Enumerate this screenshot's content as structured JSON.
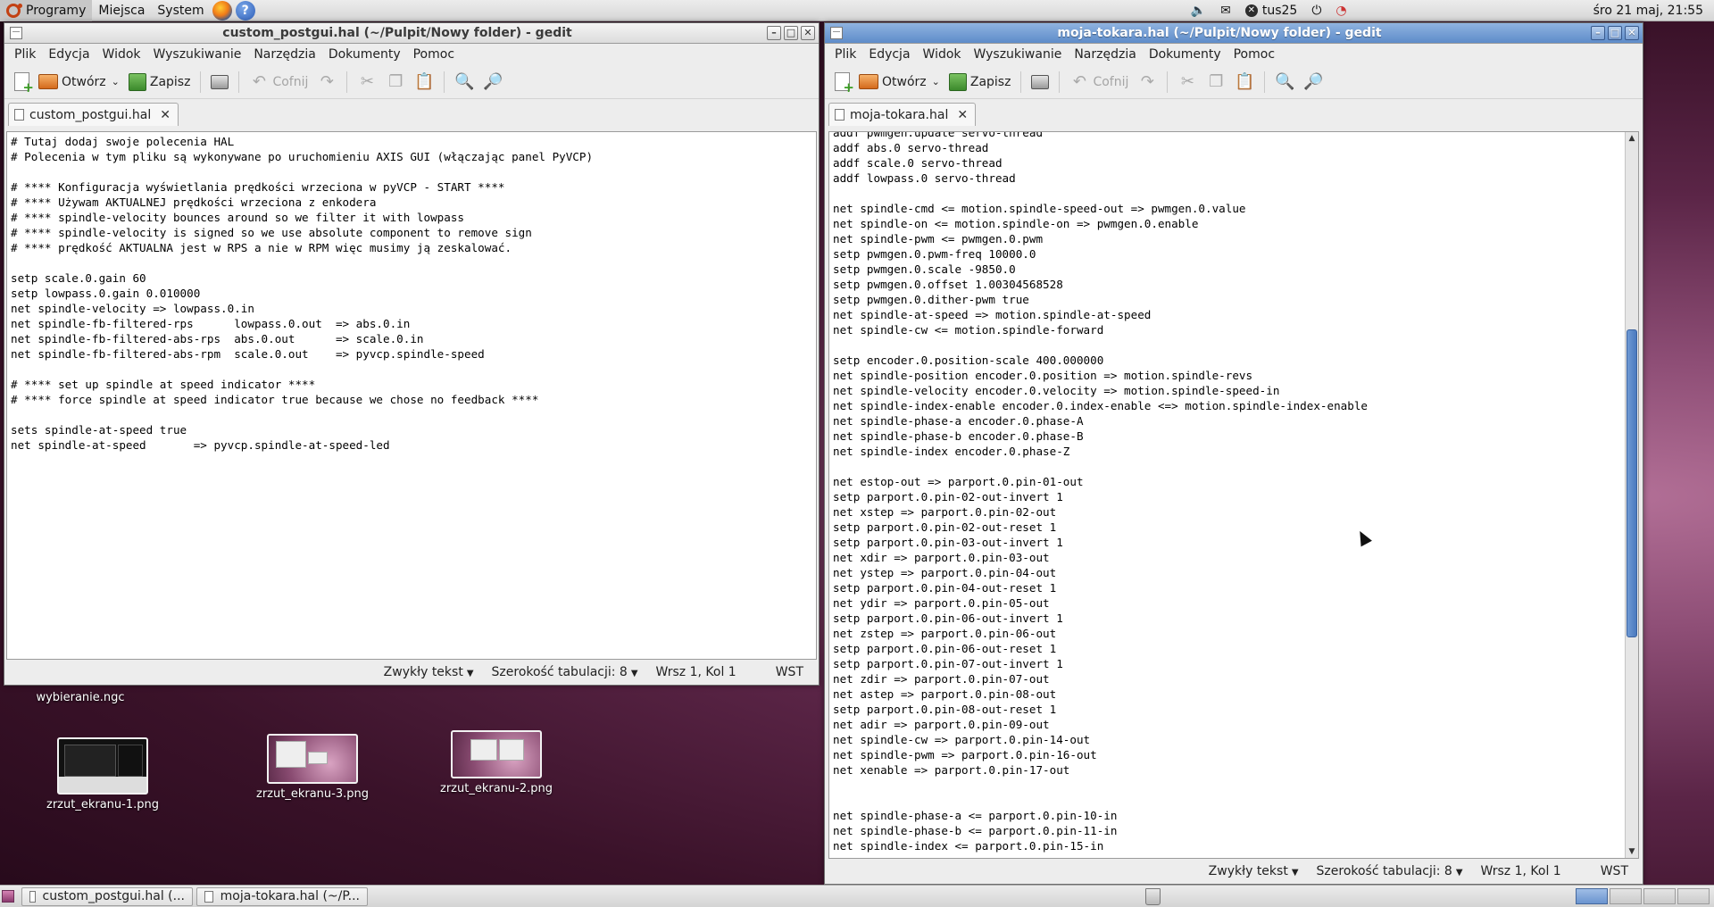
{
  "top_panel": {
    "menus": [
      "Programy",
      "Miejsca",
      "System"
    ],
    "user": "tus25",
    "clock": "śro 21 maj, 21:55"
  },
  "left_window": {
    "title": "custom_postgui.hal (~/Pulpit/Nowy folder) - gedit",
    "menu": [
      "Plik",
      "Edycja",
      "Widok",
      "Wyszukiwanie",
      "Narzędzia",
      "Dokumenty",
      "Pomoc"
    ],
    "toolbar": {
      "open": "Otwórz",
      "save": "Zapisz",
      "undo": "Cofnij"
    },
    "tab": "custom_postgui.hal",
    "lines": [
      "# Tutaj dodaj swoje polecenia HAL",
      "# Polecenia w tym pliku są wykonywane po uruchomieniu AXIS GUI (włączając panel PyVCP)",
      "",
      "# **** Konfiguracja wyświetlania prędkości wrzeciona w pyVCP - START ****",
      "# **** Używam AKTUALNEJ prędkości wrzeciona z enkodera",
      "# **** spindle-velocity bounces around so we filter it with lowpass",
      "# **** spindle-velocity is signed so we use absolute component to remove sign",
      "# **** prędkość AKTUALNA jest w RPS a nie w RPM więc musimy ją zeskalować.",
      "",
      "setp scale.0.gain 60",
      "setp lowpass.0.gain 0.010000",
      "net spindle-velocity => lowpass.0.in",
      "net spindle-fb-filtered-rps      lowpass.0.out  => abs.0.in",
      "net spindle-fb-filtered-abs-rps  abs.0.out      => scale.0.in",
      "net spindle-fb-filtered-abs-rpm  scale.0.out    => pyvcp.spindle-speed",
      "",
      "# **** set up spindle at speed indicator ****",
      "# **** force spindle at speed indicator true because we chose no feedback ****",
      "",
      "sets spindle-at-speed true",
      "net spindle-at-speed       => pyvcp.spindle-at-speed-led"
    ],
    "status": {
      "lang": "Zwykły tekst",
      "tab": "Szerokość tabulacji:  8",
      "pos": "Wrsz 1, Kol 1",
      "mode": "WST"
    }
  },
  "right_window": {
    "title": "moja-tokara.hal (~/Pulpit/Nowy folder) - gedit",
    "menu": [
      "Plik",
      "Edycja",
      "Widok",
      "Wyszukiwanie",
      "Narzędzia",
      "Dokumenty",
      "Pomoc"
    ],
    "toolbar": {
      "open": "Otwórz",
      "save": "Zapisz",
      "undo": "Cofnij"
    },
    "tab": "moja-tokara.hal",
    "lines": [
      "addf pwmgen.update servo-thread",
      "addf abs.0 servo-thread",
      "addf scale.0 servo-thread",
      "addf lowpass.0 servo-thread",
      "",
      "net spindle-cmd <= motion.spindle-speed-out => pwmgen.0.value",
      "net spindle-on <= motion.spindle-on => pwmgen.0.enable",
      "net spindle-pwm <= pwmgen.0.pwm",
      "setp pwmgen.0.pwm-freq 10000.0",
      "setp pwmgen.0.scale -9850.0",
      "setp pwmgen.0.offset 1.00304568528",
      "setp pwmgen.0.dither-pwm true",
      "net spindle-at-speed => motion.spindle-at-speed",
      "net spindle-cw <= motion.spindle-forward",
      "",
      "setp encoder.0.position-scale 400.000000",
      "net spindle-position encoder.0.position => motion.spindle-revs",
      "net spindle-velocity encoder.0.velocity => motion.spindle-speed-in",
      "net spindle-index-enable encoder.0.index-enable <=> motion.spindle-index-enable",
      "net spindle-phase-a encoder.0.phase-A",
      "net spindle-phase-b encoder.0.phase-B",
      "net spindle-index encoder.0.phase-Z",
      "",
      "net estop-out => parport.0.pin-01-out",
      "setp parport.0.pin-02-out-invert 1",
      "net xstep => parport.0.pin-02-out",
      "setp parport.0.pin-02-out-reset 1",
      "setp parport.0.pin-03-out-invert 1",
      "net xdir => parport.0.pin-03-out",
      "net ystep => parport.0.pin-04-out",
      "setp parport.0.pin-04-out-reset 1",
      "net ydir => parport.0.pin-05-out",
      "setp parport.0.pin-06-out-invert 1",
      "net zstep => parport.0.pin-06-out",
      "setp parport.0.pin-06-out-reset 1",
      "setp parport.0.pin-07-out-invert 1",
      "net zdir => parport.0.pin-07-out",
      "net astep => parport.0.pin-08-out",
      "setp parport.0.pin-08-out-reset 1",
      "net adir => parport.0.pin-09-out",
      "net spindle-cw => parport.0.pin-14-out",
      "net spindle-pwm => parport.0.pin-16-out",
      "net xenable => parport.0.pin-17-out",
      "",
      "",
      "net spindle-phase-a <= parport.0.pin-10-in",
      "net spindle-phase-b <= parport.0.pin-11-in",
      "net spindle-index <= parport.0.pin-15-in"
    ],
    "status": {
      "lang": "Zwykły tekst",
      "tab": "Szerokość tabulacji:  8",
      "pos": "Wrsz 1, Kol 1",
      "mode": "WST"
    }
  },
  "desktop_icons": [
    "wybieranie.ngc",
    "zrzut_ekranu-1.png",
    "zrzut_ekranu-3.png",
    "zrzut_ekranu-2.png"
  ],
  "taskbar": [
    "custom_postgui.hal (...",
    "moja-tokara.hal (~/P..."
  ]
}
